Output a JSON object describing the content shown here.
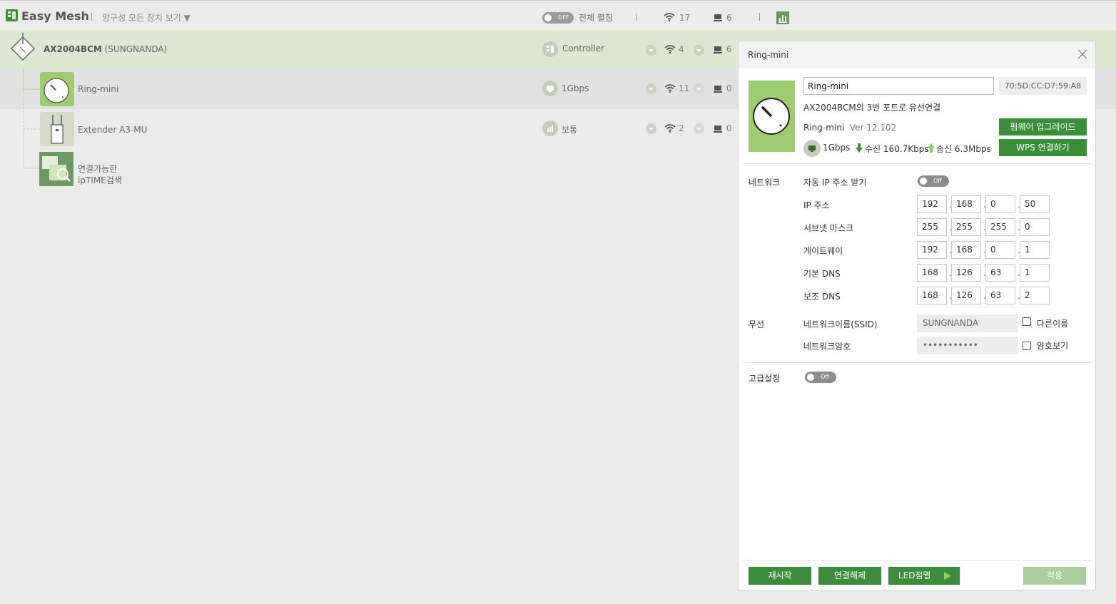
{
  "header": {
    "app_title": "Easy Mesh",
    "view_all_label": "망구성 모든 장치 보기",
    "expand_toggle_state": "OFF",
    "expand_label": "전체 펼침",
    "wifi_count": "17",
    "wired_count": "6"
  },
  "devices": [
    {
      "name": "AX2004BCM",
      "ssid": "(SUNGNANDA)",
      "role": "Controller",
      "wifi_count": "4",
      "wired_count": "6"
    },
    {
      "name": "Ring-mini",
      "link": "1Gbps",
      "wifi_count": "11",
      "wired_count": "0"
    },
    {
      "name": "Extender A3-MU",
      "link": "보통",
      "wifi_count": "2",
      "wired_count": "0"
    }
  ],
  "search_item": {
    "line1": "연결가능한",
    "line2": "ipTIME검색"
  },
  "panel": {
    "title": "Ring-mini",
    "device_name_value": "Ring-mini",
    "mac": "70:5D:CC:D7:59:A8",
    "connection_desc": "AX2004BCM의 3번 포트로 유선연결",
    "model": "Ring-mini",
    "version": "Ver 12.102",
    "link_speed": "1Gbps",
    "rx_label": "수신",
    "rx_value": "160.7Kbps",
    "tx_label": "송신",
    "tx_value": "6.3Mbps",
    "firmware_button": "펌웨어 업그레이드",
    "wps_button": "WPS 연결하기",
    "network_section": "네트워크",
    "auto_ip_label": "자동 IP 주소 받기",
    "auto_ip_state": "Off",
    "ip_fields": [
      {
        "label": "IP 주소",
        "octets": [
          "192",
          "168",
          "0",
          "50"
        ]
      },
      {
        "label": "서브넷 마스크",
        "octets": [
          "255",
          "255",
          "255",
          "0"
        ]
      },
      {
        "label": "게이트웨이",
        "octets": [
          "192",
          "168",
          "0",
          "1"
        ]
      },
      {
        "label": "기본 DNS",
        "octets": [
          "168",
          "126",
          "63",
          "1"
        ]
      },
      {
        "label": "보조 DNS",
        "octets": [
          "168",
          "126",
          "63",
          "2"
        ]
      }
    ],
    "wireless_section": "무선",
    "ssid_label": "네트워크이름(SSID)",
    "ssid_value": "SUNGNANDA",
    "other_name_label": "다른이름",
    "password_label": "네트워크암호",
    "password_value": "•••••••••••",
    "show_password_label": "암호보기",
    "advanced_label": "고급설정",
    "advanced_state": "Off",
    "restart_button": "재시작",
    "disconnect_button": "연결해제",
    "led_button": "LED점멸",
    "apply_button": "적용"
  },
  "colors": {
    "accent_green": "#3a8e3a",
    "thumb_green": "#a0cc70",
    "selected_row": "#dde8d1"
  }
}
